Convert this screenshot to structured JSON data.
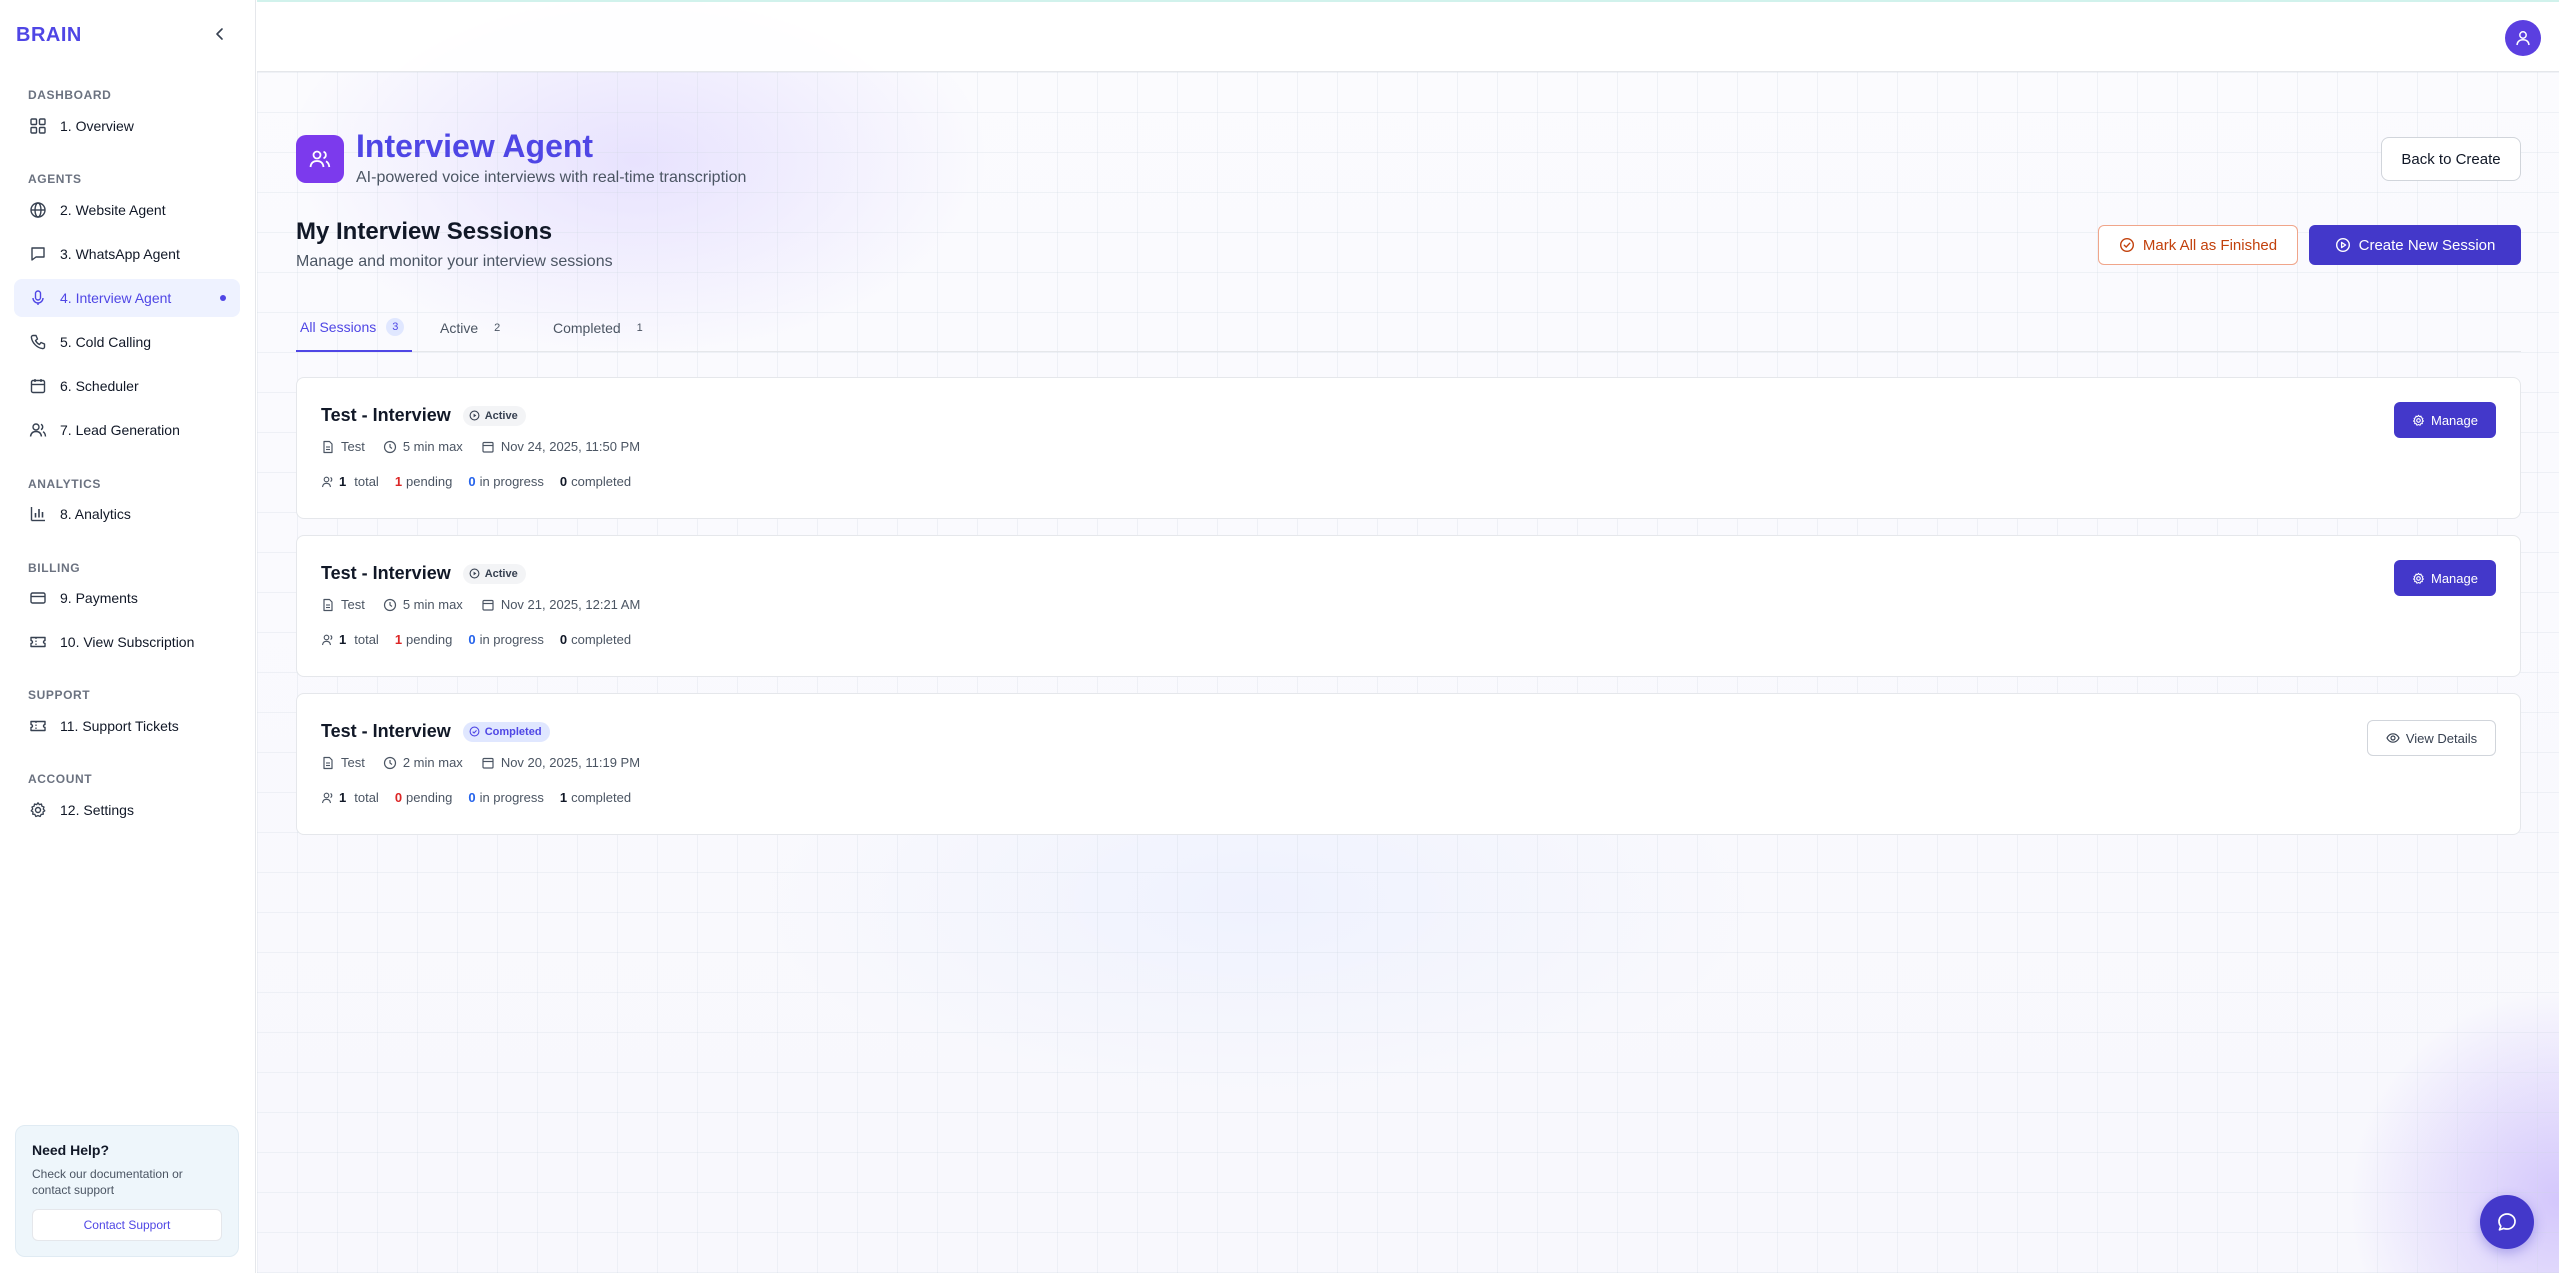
{
  "brand": "BRAIN",
  "sidebar": {
    "sections": [
      {
        "label": "DASHBOARD",
        "items": [
          {
            "label": "1. Overview",
            "icon": "grid-icon"
          }
        ]
      },
      {
        "label": "AGENTS",
        "items": [
          {
            "label": "2. Website Agent",
            "icon": "globe-icon"
          },
          {
            "label": "3. WhatsApp Agent",
            "icon": "chat-icon"
          },
          {
            "label": "4. Interview Agent",
            "icon": "mic-icon",
            "active": true
          },
          {
            "label": "5. Cold Calling",
            "icon": "phone-icon"
          },
          {
            "label": "6. Scheduler",
            "icon": "calendar-icon"
          },
          {
            "label": "7. Lead Generation",
            "icon": "users-icon"
          }
        ]
      },
      {
        "label": "ANALYTICS",
        "items": [
          {
            "label": "8. Analytics",
            "icon": "bar-chart-icon"
          }
        ]
      },
      {
        "label": "BILLING",
        "items": [
          {
            "label": "9. Payments",
            "icon": "credit-card-icon"
          },
          {
            "label": "10. View Subscription",
            "icon": "ticket-icon"
          }
        ]
      },
      {
        "label": "SUPPORT",
        "items": [
          {
            "label": "11. Support Tickets",
            "icon": "ticket-icon"
          }
        ]
      },
      {
        "label": "ACCOUNT",
        "items": [
          {
            "label": "12. Settings",
            "icon": "gear-icon"
          }
        ]
      }
    ],
    "help": {
      "title": "Need Help?",
      "text": "Check our documentation or contact support",
      "button": "Contact Support"
    }
  },
  "page": {
    "title": "Interview Agent",
    "subtitle": "AI-powered voice interviews with real-time transcription",
    "back_button": "Back to Create",
    "section_title": "My Interview Sessions",
    "section_subtitle": "Manage and monitor your interview sessions",
    "mark_all_button": "Mark All as Finished",
    "create_button": "Create New Session"
  },
  "tabs": [
    {
      "label": "All Sessions",
      "count": "3",
      "active": true
    },
    {
      "label": "Active",
      "count": "2"
    },
    {
      "label": "Completed",
      "count": "1"
    }
  ],
  "sessions": [
    {
      "title": "Test - Interview",
      "status": "Active",
      "type": "Test",
      "duration": "5 min max",
      "date": "Nov 24, 2025, 11:50 PM",
      "total": "1",
      "pending": "1",
      "in_progress": "0",
      "completed": "0",
      "action": "Manage"
    },
    {
      "title": "Test - Interview",
      "status": "Active",
      "type": "Test",
      "duration": "5 min max",
      "date": "Nov 21, 2025, 12:21 AM",
      "total": "1",
      "pending": "1",
      "in_progress": "0",
      "completed": "0",
      "action": "Manage"
    },
    {
      "title": "Test - Interview",
      "status": "Completed",
      "type": "Test",
      "duration": "2 min max",
      "date": "Nov 20, 2025, 11:19 PM",
      "total": "1",
      "pending": "0",
      "in_progress": "0",
      "completed": "1",
      "action": "View Details"
    }
  ],
  "stat_labels": {
    "total": "total",
    "pending": "pending",
    "in_progress": "in progress",
    "completed": "completed"
  },
  "colors": {
    "accent": "#4f46e5",
    "primary_button": "#4338ca",
    "pending": "#dc2626",
    "in_progress": "#2563eb"
  }
}
